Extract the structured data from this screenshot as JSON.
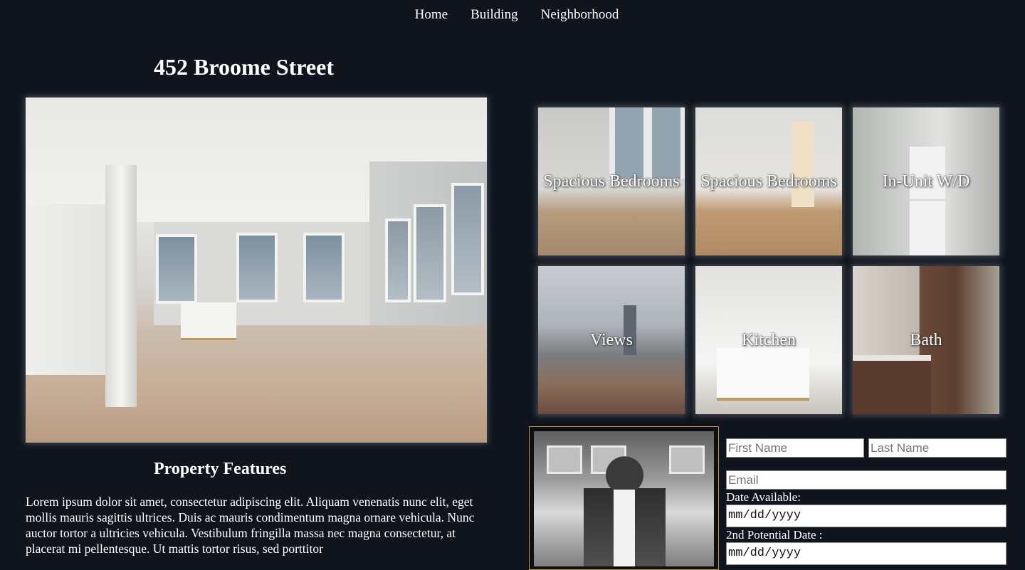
{
  "nav": {
    "items": [
      "Home",
      "Building",
      "Neighborhood"
    ]
  },
  "page_title": "452 Broome Street",
  "hero": {
    "alt": "Open loft living room with kitchen and large windows"
  },
  "tiles": [
    {
      "label": "Spacious Bedrooms"
    },
    {
      "label": "Spacious Bedrooms"
    },
    {
      "label": "In-Unit W/D"
    },
    {
      "label": "Views"
    },
    {
      "label": "Kitchen"
    },
    {
      "label": "Bath"
    }
  ],
  "features": {
    "title": "Property Features",
    "text": "Lorem ipsum dolor sit amet, consectetur adipiscing elit. Aliquam venenatis nunc elit, eget mollis mauris sagittis ultrices. Duis ac mauris condimentum magna ornare vehicula. Nunc auctor tortor a ultricies vehicula. Vestibulum fringilla massa nec magna consectetur, at placerat mi pellentesque. Ut mattis tortor risus, sed porttitor"
  },
  "form": {
    "first_name_placeholder": "First Name",
    "last_name_placeholder": "Last Name",
    "email_placeholder": "Email",
    "date_available_label": "Date Available:",
    "date_available_value": "mm/dd/yyyy",
    "second_date_label": "2nd Potential Date :",
    "second_date_value": "mm/dd/yyyy"
  },
  "colors": {
    "background": "#10141c",
    "agent_border": "#b79a55"
  }
}
